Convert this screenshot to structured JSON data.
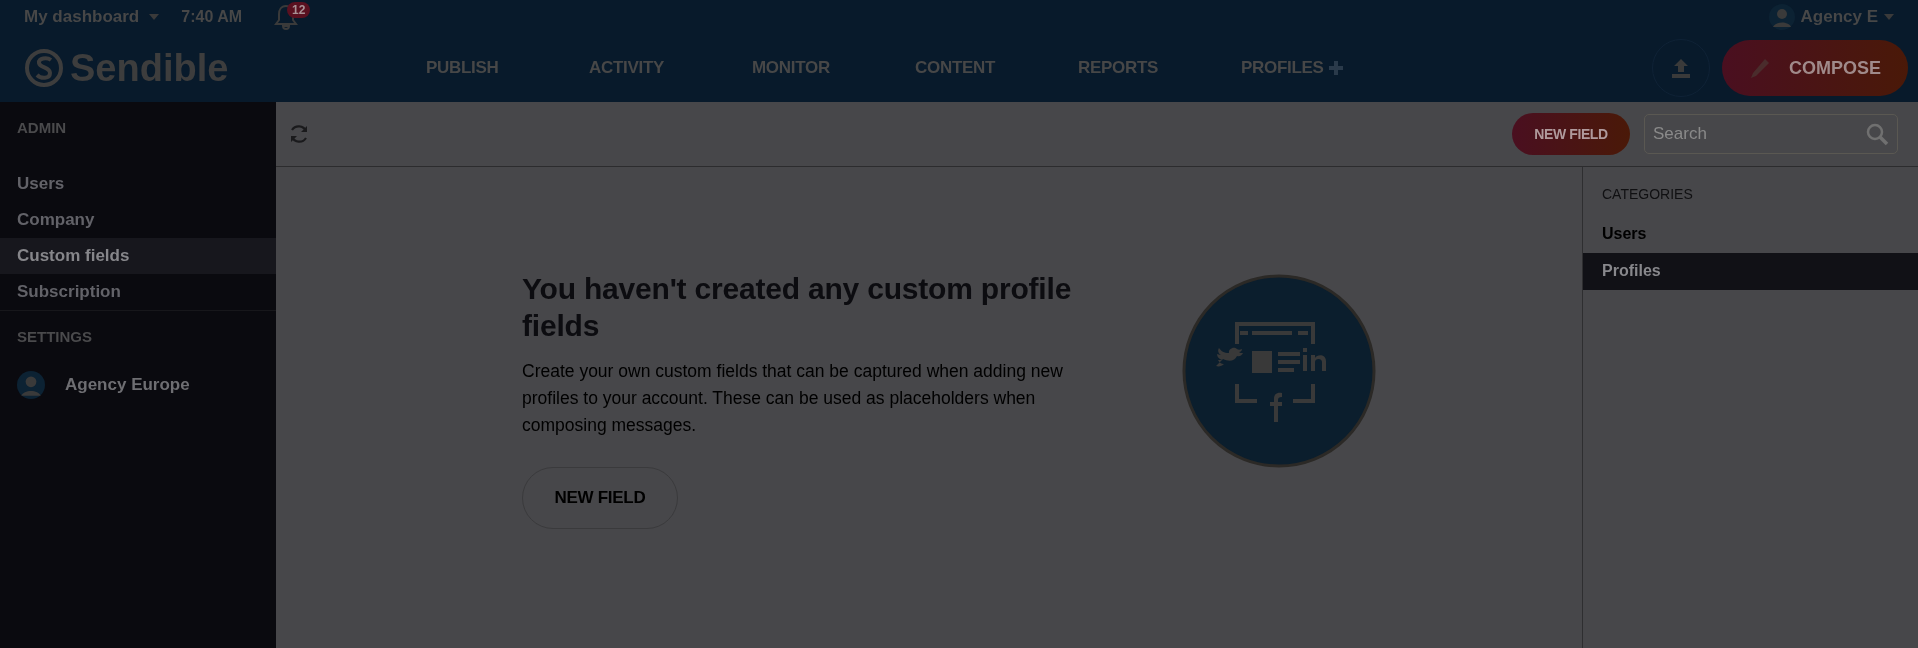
{
  "top_bar": {
    "dashboard_menu": "My dashboard",
    "time": "7:40 AM",
    "notification_count": "12",
    "account": "Agency E"
  },
  "header": {
    "logo": "Sendible",
    "nav": [
      {
        "label": "PUBLISH",
        "add": false
      },
      {
        "label": "ACTIVITY",
        "add": false
      },
      {
        "label": "MONITOR",
        "add": false
      },
      {
        "label": "CONTENT",
        "add": false
      },
      {
        "label": "REPORTS",
        "add": false
      },
      {
        "label": "PROFILES",
        "add": true
      }
    ],
    "compose_button": "COMPOSE"
  },
  "sidebar": {
    "sections": [
      {
        "title": "ADMIN",
        "items": [
          {
            "label": "Users",
            "kind": "link",
            "selected": false
          },
          {
            "label": "Company",
            "kind": "link",
            "selected": false
          },
          {
            "label": "Custom fields",
            "kind": "link",
            "selected": true
          },
          {
            "label": "Subscription",
            "kind": "link",
            "selected": false
          }
        ]
      },
      {
        "title": "SETTINGS",
        "items": [
          {
            "label": "Agency Europe",
            "kind": "account"
          }
        ]
      }
    ]
  },
  "toolbar": {
    "new_field_button": "NEW FIELD",
    "search": {
      "placeholder": "Search"
    }
  },
  "empty_state": {
    "title": "You haven't created any custom profile fields",
    "description": "Create your own custom fields that can be captured when adding new profiles to your account. These can be used as placeholders when composing messages.",
    "button": "NEW FIELD"
  },
  "categories": {
    "title": "CATEGORIES",
    "items": [
      {
        "label": "Users",
        "selected": false
      },
      {
        "label": "Profiles",
        "selected": true
      }
    ]
  }
}
